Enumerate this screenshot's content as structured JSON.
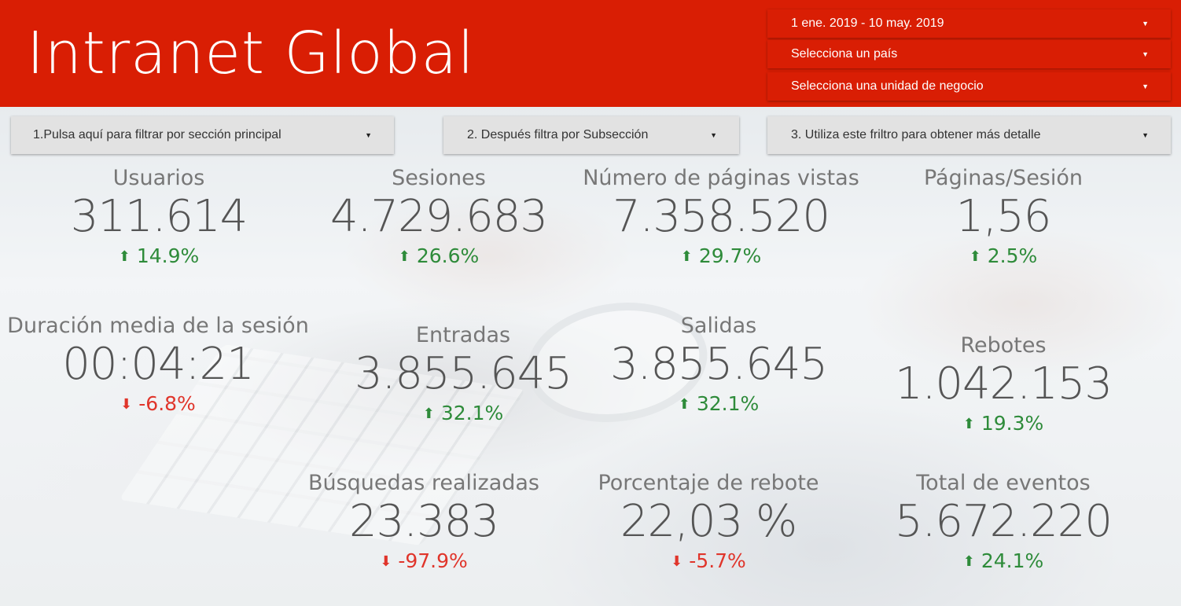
{
  "header": {
    "title": "Intranet Global",
    "date_range": "1 ene. 2019 - 10 may. 2019",
    "country_select": "Selecciona un país",
    "business_unit_select": "Selecciona una unidad de negocio"
  },
  "filters": {
    "main_section": "1.Pulsa aquí para filtrar por sección principal",
    "subsection": "2. Después filtra por Subsección",
    "detail": "3. Utiliza este friltro para obtener más detalle"
  },
  "icons": {
    "dropdown": "caret-down-icon",
    "up": "arrow-up-icon",
    "down": "arrow-down-icon"
  },
  "colors": {
    "brand": "#d91e04",
    "up": "#2e8b3a",
    "down": "#e0352b"
  },
  "metrics": [
    {
      "label": "Usuarios",
      "value": "311.614",
      "delta": "14.9%",
      "direction": "up"
    },
    {
      "label": "Sesiones",
      "value": "4.729.683",
      "delta": "26.6%",
      "direction": "up"
    },
    {
      "label": "Número de páginas vistas",
      "value": "7.358.520",
      "delta": "29.7%",
      "direction": "up"
    },
    {
      "label": "Páginas/Sesión",
      "value": "1,56",
      "delta": "2.5%",
      "direction": "up"
    },
    {
      "label": "Duración media de la sesión",
      "value": "00:04:21",
      "delta": "-6.8%",
      "direction": "down"
    },
    {
      "label": "Entradas",
      "value": "3.855.645",
      "delta": "32.1%",
      "direction": "up"
    },
    {
      "label": "Salidas",
      "value": "3.855.645",
      "delta": "32.1%",
      "direction": "up"
    },
    {
      "label": "Rebotes",
      "value": "1.042.153",
      "delta": "19.3%",
      "direction": "up"
    },
    {
      "label": "Búsquedas realizadas",
      "value": "23.383",
      "delta": "-97.9%",
      "direction": "down"
    },
    {
      "label": "Porcentaje de rebote",
      "value": "22,03 %",
      "delta": "-5.7%",
      "direction": "down"
    },
    {
      "label": "Total de eventos",
      "value": "5.672.220",
      "delta": "24.1%",
      "direction": "up"
    }
  ]
}
